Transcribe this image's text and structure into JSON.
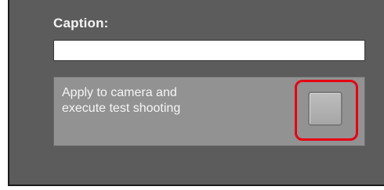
{
  "caption": {
    "label": "Caption:",
    "value": "",
    "placeholder": ""
  },
  "apply": {
    "line1": "Apply to camera and",
    "line2": "execute test shooting"
  },
  "colors": {
    "panel_bg": "#5c5c5c",
    "apply_bg": "#929292",
    "highlight": "#e60012"
  }
}
